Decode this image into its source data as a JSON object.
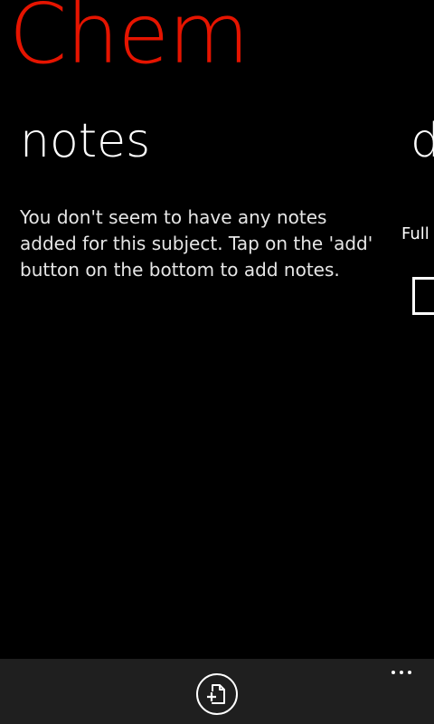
{
  "app": {
    "title": "Chem",
    "accent_color": "#e51400"
  },
  "pivot": {
    "active_header": "notes",
    "next_header_peek": "d"
  },
  "notes": {
    "empty_message": "You don't seem to have any notes added for this subject. Tap on the 'add' button on the bottom to add notes."
  },
  "next_section": {
    "label_peek": "Full"
  },
  "app_bar": {
    "add_icon": "add-note-icon",
    "more_icon": "ellipsis-icon"
  }
}
